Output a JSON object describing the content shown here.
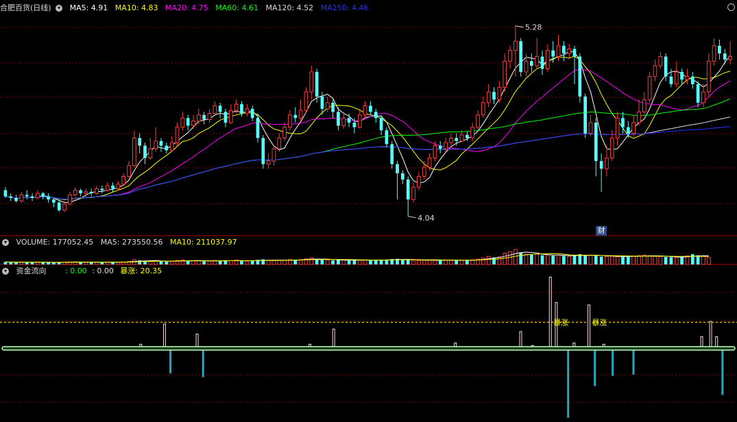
{
  "main": {
    "title": "合肥百货(日线)",
    "ma": [
      {
        "label": "MA5: 4.91",
        "color": "#ffffff"
      },
      {
        "label": "MA10: 4.83",
        "color": "#ffff00"
      },
      {
        "label": "MA20: 4.75",
        "color": "#ff00ff"
      },
      {
        "label": "MA60: 4.61",
        "color": "#00ff00"
      },
      {
        "label": "MA120: 4.52",
        "color": "#dddddd"
      },
      {
        "label": "MA250: 4.46",
        "color": "#2233ff"
      }
    ]
  },
  "volume_panel": {
    "labels": [
      {
        "label": "VOLUME: 177052.45",
        "color": "#dddddd"
      },
      {
        "label": "MA5: 273550.56",
        "color": "#dddddd"
      },
      {
        "label": "MA10: 211037.97",
        "color": "#ffff00"
      }
    ]
  },
  "flow_panel": {
    "title": "资金流向",
    "v1": ": 0.00",
    "v2": ": 0.00",
    "v3": "暴涨: 20.35",
    "annotation": "暴涨",
    "marker": "财"
  },
  "colors": {
    "up": "#ff3c3c",
    "down": "#54ffff",
    "grid": "#8b0000"
  },
  "chart_data": {
    "type": "candlestick",
    "price_range": [
      3.95,
      5.35
    ],
    "high_label": "5.28",
    "low_label": "4.04",
    "ohlc": [
      [
        4.21,
        4.17,
        4.23,
        4.16
      ],
      [
        4.17,
        4.16,
        4.19,
        4.14
      ],
      [
        4.16,
        4.14,
        4.18,
        4.13
      ],
      [
        4.14,
        4.18,
        4.2,
        4.13
      ],
      [
        4.18,
        4.17,
        4.21,
        4.15
      ],
      [
        4.17,
        4.16,
        4.19,
        4.14
      ],
      [
        4.16,
        4.19,
        4.21,
        4.15
      ],
      [
        4.19,
        4.17,
        4.2,
        4.15
      ],
      [
        4.17,
        4.15,
        4.19,
        4.13
      ],
      [
        4.15,
        4.13,
        4.16,
        4.1
      ],
      [
        4.13,
        4.08,
        4.14,
        4.07
      ],
      [
        4.08,
        4.12,
        4.14,
        4.07
      ],
      [
        4.12,
        4.18,
        4.2,
        4.11
      ],
      [
        4.18,
        4.21,
        4.23,
        4.17
      ],
      [
        4.21,
        4.19,
        4.22,
        4.17
      ],
      [
        4.19,
        4.2,
        4.22,
        4.17
      ],
      [
        4.2,
        4.19,
        4.22,
        4.17
      ],
      [
        4.19,
        4.22,
        4.24,
        4.18
      ],
      [
        4.22,
        4.21,
        4.24,
        4.19
      ],
      [
        4.21,
        4.24,
        4.26,
        4.2
      ],
      [
        4.24,
        4.22,
        4.26,
        4.2
      ],
      [
        4.22,
        4.25,
        4.27,
        4.21
      ],
      [
        4.25,
        4.3,
        4.32,
        4.24
      ],
      [
        4.3,
        4.37,
        4.4,
        4.29
      ],
      [
        4.37,
        4.55,
        4.6,
        4.36
      ],
      [
        4.55,
        4.5,
        4.58,
        4.45
      ],
      [
        4.5,
        4.42,
        4.52,
        4.38
      ],
      [
        4.42,
        4.48,
        4.55,
        4.41
      ],
      [
        4.48,
        4.53,
        4.62,
        4.46
      ],
      [
        4.53,
        4.5,
        4.55,
        4.46
      ],
      [
        4.5,
        4.47,
        4.52,
        4.45
      ],
      [
        4.47,
        4.52,
        4.56,
        4.46
      ],
      [
        4.52,
        4.62,
        4.65,
        4.5
      ],
      [
        4.62,
        4.68,
        4.72,
        4.6
      ],
      [
        4.68,
        4.63,
        4.7,
        4.6
      ],
      [
        4.63,
        4.66,
        4.7,
        4.61
      ],
      [
        4.66,
        4.7,
        4.74,
        4.64
      ],
      [
        4.7,
        4.67,
        4.72,
        4.64
      ],
      [
        4.67,
        4.71,
        4.74,
        4.65
      ],
      [
        4.71,
        4.76,
        4.79,
        4.69
      ],
      [
        4.76,
        4.72,
        4.78,
        4.68
      ],
      [
        4.72,
        4.65,
        4.74,
        4.62
      ],
      [
        4.65,
        4.73,
        4.77,
        4.64
      ],
      [
        4.73,
        4.77,
        4.8,
        4.71
      ],
      [
        4.77,
        4.71,
        4.79,
        4.69
      ],
      [
        4.71,
        4.74,
        4.77,
        4.69
      ],
      [
        4.74,
        4.68,
        4.76,
        4.66
      ],
      [
        4.68,
        4.55,
        4.71,
        4.52
      ],
      [
        4.55,
        4.38,
        4.57,
        4.35
      ],
      [
        4.38,
        4.4,
        4.45,
        4.35
      ],
      [
        4.4,
        4.48,
        4.5,
        4.37
      ],
      [
        4.48,
        4.55,
        4.58,
        4.46
      ],
      [
        4.55,
        4.62,
        4.65,
        4.53
      ],
      [
        4.62,
        4.7,
        4.73,
        4.6
      ],
      [
        4.7,
        4.68,
        4.75,
        4.65
      ],
      [
        4.68,
        4.73,
        4.8,
        4.66
      ],
      [
        4.73,
        4.85,
        4.88,
        4.71
      ],
      [
        4.85,
        4.98,
        5.02,
        4.8
      ],
      [
        4.98,
        4.82,
        5.0,
        4.78
      ],
      [
        4.82,
        4.74,
        4.85,
        4.7
      ],
      [
        4.74,
        4.78,
        4.82,
        4.72
      ],
      [
        4.78,
        4.72,
        4.8,
        4.68
      ],
      [
        4.72,
        4.63,
        4.75,
        4.6
      ],
      [
        4.63,
        4.68,
        4.72,
        4.61
      ],
      [
        4.68,
        4.65,
        4.71,
        4.62
      ],
      [
        4.65,
        4.62,
        4.68,
        4.58
      ],
      [
        4.62,
        4.7,
        4.73,
        4.61
      ],
      [
        4.7,
        4.76,
        4.79,
        4.68
      ],
      [
        4.76,
        4.72,
        4.79,
        4.7
      ],
      [
        4.72,
        4.68,
        4.74,
        4.65
      ],
      [
        4.68,
        4.6,
        4.7,
        4.57
      ],
      [
        4.6,
        4.51,
        4.62,
        4.49
      ],
      [
        4.51,
        4.38,
        4.53,
        4.35
      ],
      [
        4.38,
        4.32,
        4.4,
        4.15
      ],
      [
        4.32,
        4.28,
        4.34,
        4.25
      ],
      [
        4.28,
        4.15,
        4.3,
        4.04
      ],
      [
        4.15,
        4.23,
        4.26,
        4.13
      ],
      [
        4.23,
        4.3,
        4.33,
        4.21
      ],
      [
        4.3,
        4.36,
        4.4,
        4.28
      ],
      [
        4.36,
        4.42,
        4.45,
        4.34
      ],
      [
        4.42,
        4.5,
        4.53,
        4.4
      ],
      [
        4.5,
        4.48,
        4.53,
        4.45
      ],
      [
        4.48,
        4.52,
        4.55,
        4.46
      ],
      [
        4.52,
        4.55,
        4.58,
        4.5
      ],
      [
        4.55,
        4.53,
        4.58,
        4.5
      ],
      [
        4.53,
        4.57,
        4.6,
        4.52
      ],
      [
        4.57,
        4.55,
        4.59,
        4.53
      ],
      [
        4.55,
        4.62,
        4.65,
        4.53
      ],
      [
        4.62,
        4.7,
        4.73,
        4.6
      ],
      [
        4.7,
        4.78,
        4.82,
        4.68
      ],
      [
        4.78,
        4.85,
        4.9,
        4.75
      ],
      [
        4.85,
        4.8,
        4.88,
        4.77
      ],
      [
        4.8,
        4.88,
        4.92,
        4.78
      ],
      [
        4.88,
        5.05,
        5.1,
        4.85
      ],
      [
        5.05,
        5.12,
        5.15,
        5.0
      ],
      [
        5.12,
        5.18,
        5.28,
        4.95
      ],
      [
        5.18,
        4.98,
        5.2,
        4.95
      ],
      [
        4.98,
        5.05,
        5.1,
        4.95
      ],
      [
        5.05,
        5.02,
        5.1,
        4.98
      ],
      [
        5.02,
        5.08,
        5.2,
        5.0
      ],
      [
        5.08,
        5.0,
        5.12,
        4.96
      ],
      [
        5.0,
        5.12,
        5.16,
        4.98
      ],
      [
        5.12,
        5.08,
        5.18,
        5.04
      ],
      [
        5.08,
        5.15,
        5.22,
        5.05
      ],
      [
        5.15,
        5.1,
        5.18,
        5.05
      ],
      [
        5.1,
        5.13,
        5.16,
        5.06
      ],
      [
        5.13,
        5.08,
        5.15,
        4.9
      ],
      [
        5.08,
        4.82,
        5.1,
        4.78
      ],
      [
        4.82,
        4.58,
        4.84,
        4.55
      ],
      [
        4.58,
        4.65,
        4.7,
        4.56
      ],
      [
        4.65,
        4.4,
        4.68,
        4.3
      ],
      [
        4.4,
        4.35,
        4.45,
        4.2
      ],
      [
        4.35,
        4.42,
        4.5,
        4.3
      ],
      [
        4.42,
        4.55,
        4.6,
        4.4
      ],
      [
        4.55,
        4.68,
        4.72,
        4.5
      ],
      [
        4.68,
        4.62,
        4.72,
        4.58
      ],
      [
        4.62,
        4.58,
        4.66,
        4.55
      ],
      [
        4.58,
        4.65,
        4.7,
        4.56
      ],
      [
        4.65,
        4.72,
        4.8,
        4.63
      ],
      [
        4.72,
        4.8,
        4.85,
        4.7
      ],
      [
        4.8,
        4.95,
        4.98,
        4.78
      ],
      [
        4.95,
        5.02,
        5.06,
        4.92
      ],
      [
        5.02,
        5.08,
        5.11,
        5.0
      ],
      [
        5.08,
        4.95,
        5.1,
        4.92
      ],
      [
        4.95,
        4.9,
        5.0,
        4.88
      ],
      [
        4.9,
        4.98,
        5.05,
        4.88
      ],
      [
        4.98,
        4.93,
        5.0,
        4.9
      ],
      [
        4.93,
        4.95,
        5.0,
        4.9
      ],
      [
        4.95,
        4.9,
        4.98,
        4.87
      ],
      [
        4.9,
        4.78,
        4.92,
        4.75
      ],
      [
        4.78,
        4.85,
        4.9,
        4.75
      ],
      [
        4.85,
        5.05,
        5.1,
        4.82
      ],
      [
        5.05,
        5.15,
        5.2,
        5.02
      ],
      [
        5.15,
        5.1,
        5.19,
        5.06
      ],
      [
        5.1,
        5.06,
        5.13,
        5.03
      ],
      [
        5.06,
        5.08,
        5.18,
        5.03
      ]
    ],
    "volume": [
      95,
      80,
      70,
      90,
      85,
      75,
      88,
      80,
      72,
      65,
      90,
      85,
      92,
      100,
      88,
      80,
      78,
      85,
      80,
      90,
      82,
      88,
      95,
      110,
      180,
      150,
      120,
      130,
      145,
      110,
      100,
      120,
      150,
      170,
      140,
      130,
      145,
      120,
      130,
      150,
      130,
      150,
      140,
      160,
      130,
      125,
      140,
      170,
      190,
      150,
      140,
      150,
      165,
      180,
      170,
      175,
      210,
      250,
      200,
      170,
      160,
      150,
      170,
      160,
      150,
      155,
      165,
      175,
      160,
      150,
      170,
      180,
      200,
      210,
      160,
      190,
      150,
      145,
      155,
      160,
      170,
      150,
      155,
      160,
      150,
      160,
      150,
      170,
      200,
      240,
      300,
      260,
      280,
      420,
      480,
      560,
      450,
      380,
      360,
      380,
      340,
      360,
      330,
      350,
      320,
      300,
      340,
      380,
      330,
      350,
      320,
      290,
      300,
      310,
      290,
      280,
      300,
      310,
      330,
      350,
      320,
      300,
      290,
      280,
      270,
      260,
      280,
      320,
      380,
      340,
      300,
      260
    ],
    "ma_latest": {
      "MA5": 4.91,
      "MA10": 4.83,
      "MA20": 4.75,
      "MA60": 4.61,
      "MA120": 4.52,
      "MA250": 4.46
    },
    "volume_latest": {
      "VOLUME": 177052.45,
      "MA5": 273550.56,
      "MA10": 211037.97
    },
    "fund_flow": {
      "zero_line": 0,
      "threshold": 20.35,
      "bars": [
        {
          "i": 46,
          "v": 3
        },
        {
          "i": 54,
          "v": 19
        },
        {
          "i": 56,
          "v": -20
        },
        {
          "i": 65,
          "v": 11
        },
        {
          "i": 67,
          "v": -23
        },
        {
          "i": 80,
          "v": 1
        },
        {
          "i": 103,
          "v": 3
        },
        {
          "i": 111,
          "v": 15
        },
        {
          "i": 143,
          "v": 1
        },
        {
          "i": 152,
          "v": 4
        },
        {
          "i": 174,
          "v": 13
        },
        {
          "i": 178,
          "v": 2
        },
        {
          "i": 184,
          "v": 56
        },
        {
          "i": 186,
          "v": 36
        },
        {
          "i": 190,
          "v": -55
        },
        {
          "i": 192,
          "v": 4
        },
        {
          "i": 197,
          "v": 34
        },
        {
          "i": 199,
          "v": -30
        },
        {
          "i": 202,
          "v": 3
        },
        {
          "i": 205,
          "v": -22
        },
        {
          "i": 212,
          "v": -21
        },
        {
          "i": 235,
          "v": 9
        },
        {
          "i": 238,
          "v": 21
        },
        {
          "i": 240,
          "v": 9
        },
        {
          "i": 242,
          "v": -37
        }
      ]
    }
  }
}
